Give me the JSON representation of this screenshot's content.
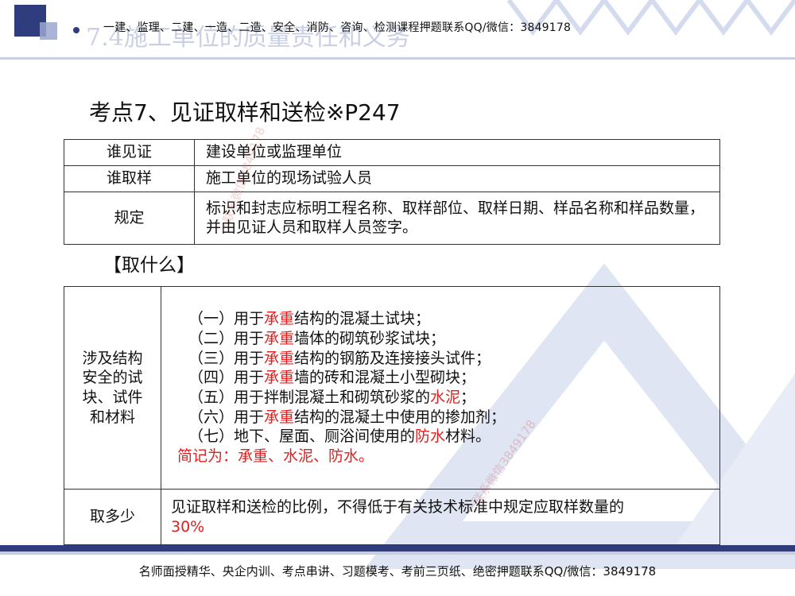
{
  "header": {
    "section_title": "7.4施工单位的质量责任和义务",
    "banner": "一建、监理、二建、一造、二造、安全、消防、咨询、检测课程押题联系QQ/微信：3849178"
  },
  "heading": "考点7、见证取样和送检※P247",
  "table1": {
    "rows": [
      {
        "key": "谁见证",
        "value": "建设单位或监理单位"
      },
      {
        "key": "谁取样",
        "value": "施工单位的现场试验人员"
      },
      {
        "key": "规定",
        "value": "标识和封志应标明工程名称、取样部位、取样日期、样品名称和样品数量，并由见证人员和取样人员签字。"
      }
    ]
  },
  "subheading": "【取什么】",
  "table2": {
    "row1_key": "涉及结构安全的试块、试件和材料",
    "items": [
      {
        "pre": "（一）用于",
        "red": "承重",
        "post": "结构的混凝土试块；"
      },
      {
        "pre": "（二）用于",
        "red": "承重",
        "post": "墙体的砌筑砂浆试块；"
      },
      {
        "pre": "（三）用于",
        "red": "承重",
        "post": "结构的钢筋及连接接头试件；"
      },
      {
        "pre": "（四）用于",
        "red": "承重",
        "post": "墙的砖和混凝土小型砌块；"
      },
      {
        "pre": "（五）用于拌制混凝土和砌筑砂浆的",
        "red": "水泥",
        "post": "；"
      },
      {
        "pre": "（六）用于",
        "red": "承重",
        "post": "结构的混凝土中使用的掺加剂；"
      },
      {
        "pre": "（七）地下、屋面、厕浴间使用的",
        "red": "防水",
        "post": "材料。"
      }
    ],
    "summary": "简记为：承重、水泥、防水。",
    "row2_key": "取多少",
    "row2_value": "见证取样和送检的比例，不得低于有关技术标准中规定应取样数量的",
    "row2_red": "30%"
  },
  "footer": "名师面授精华、央企内训、考点串讲、习题模考、考前三页纸、绝密押题联系QQ/微信：3849178",
  "watermarks": {
    "w1": "一联系微信3849178",
    "w2": "一联系微信3849178"
  },
  "colors": {
    "accent": "#2f3c7e",
    "highlight": "#e02020"
  }
}
